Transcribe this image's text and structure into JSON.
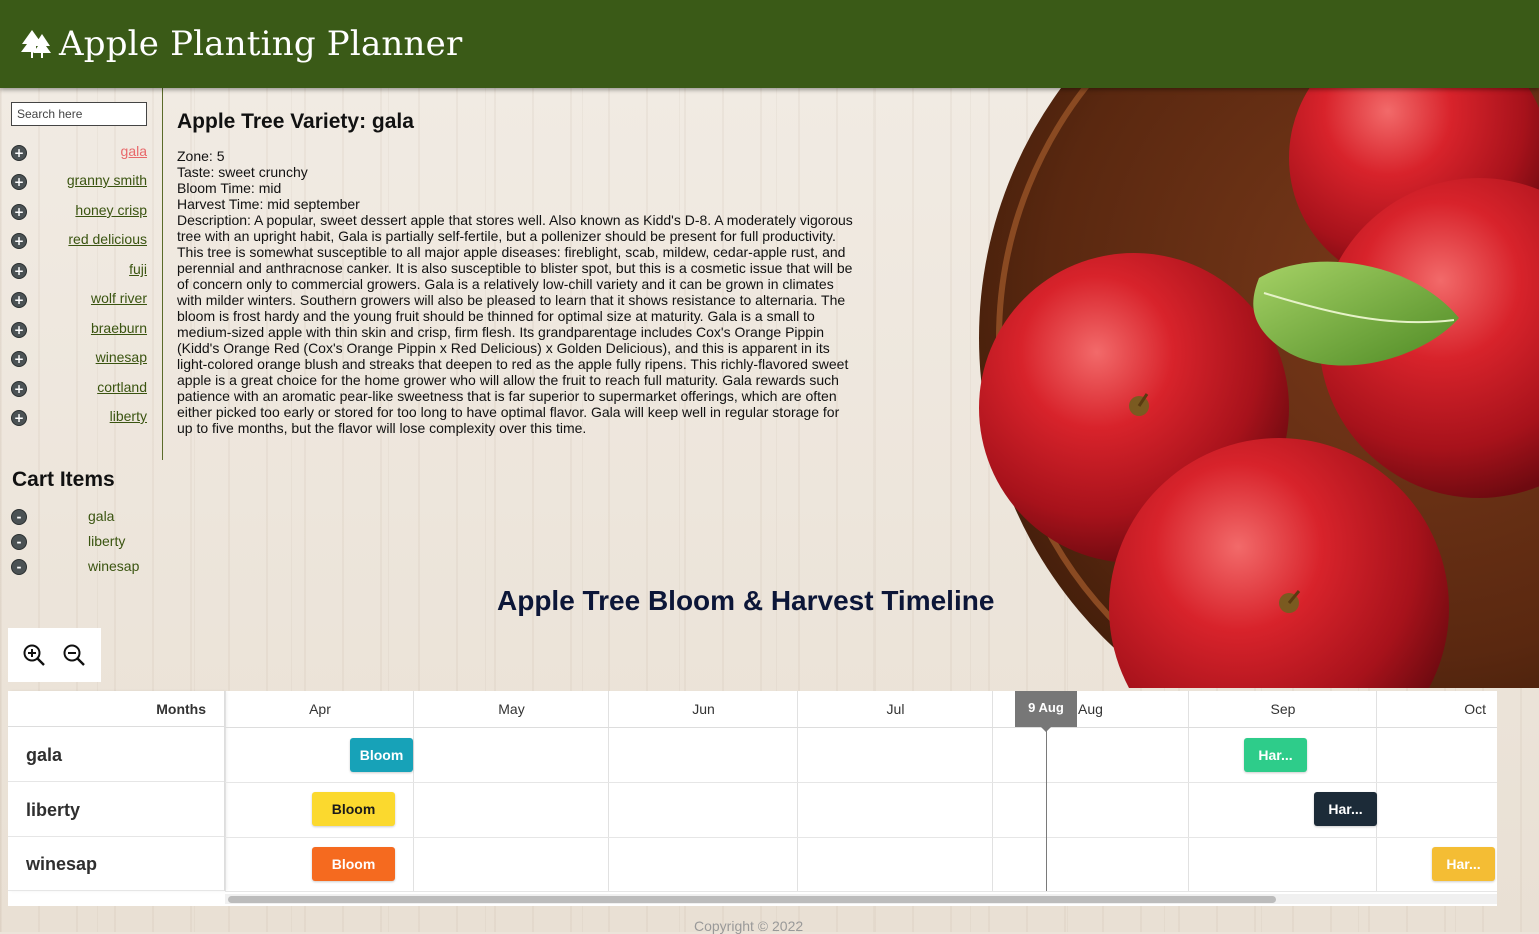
{
  "header": {
    "logo_icon": "tree-icon",
    "title": "Apple Planting Planner"
  },
  "sidebar": {
    "search_placeholder": "Search here",
    "add_icon": "+",
    "varieties": [
      {
        "name": "gala",
        "active": true
      },
      {
        "name": "granny smith"
      },
      {
        "name": "honey crisp"
      },
      {
        "name": "red delicious"
      },
      {
        "name": "fuji"
      },
      {
        "name": "wolf river"
      },
      {
        "name": "braeburn"
      },
      {
        "name": "winesap"
      },
      {
        "name": "cortland"
      },
      {
        "name": "liberty"
      }
    ]
  },
  "cart": {
    "title": "Cart Items",
    "remove_icon": "-",
    "items": [
      "gala",
      "liberty",
      "winesap"
    ]
  },
  "details": {
    "title": "Apple Tree Variety: gala",
    "zone": "Zone: 5",
    "taste": "Taste: sweet crunchy",
    "bloom": "Bloom Time: mid",
    "harvest": "Harvest Time: mid september",
    "description": "Description: A popular, sweet dessert apple that stores well. Also known as Kidd's D-8. A moderately vigorous tree with an upright habit, Gala is partially self-fertile, but a pollenizer should be present for full productivity. This tree is somewhat susceptible to all major apple diseases: fireblight, scab, mildew, cedar-apple rust, and perennial and anthracnose canker. It is also susceptible to blister spot, but this is a cosmetic issue that will be of concern only to commercial growers. Gala is a relatively low-chill variety and it can be grown in climates with milder winters. Southern growers will also be pleased to learn that it shows resistance to alternaria. The bloom is frost hardy and the young fruit should be thinned for optimal size at maturity. Gala is a small to medium-sized apple with thin skin and crisp, firm flesh. Its grandparentage includes Cox's Orange Pippin (Kidd's Orange Red (Cox's Orange Pippin x Red Delicious) x Golden Delicious), and this is apparent in its light-colored orange blush and streaks that deepen to red as the apple fully ripens. This richly-flavored sweet apple is a great choice for the home grower who will allow the fruit to reach full maturity. Gala rewards such patience with an aromatic pear-like sweetness that is far superior to supermarket offerings, which are often either picked too early or stored for too long to have optimal flavor. Gala will keep well in regular storage for up to five months, but the flavor will lose complexity over this time."
  },
  "timeline": {
    "title": "Apple Tree Bloom & Harvest Timeline",
    "zoom_in_icon": "zoom-in-icon",
    "zoom_out_icon": "zoom-out-icon",
    "left_header": "Months",
    "months": [
      "Apr",
      "May",
      "Jun",
      "Jul",
      "Aug",
      "Sep",
      "Oct"
    ],
    "today_label": "9 Aug",
    "rows": [
      {
        "name": "gala",
        "bloom": {
          "label": "Bloom",
          "color": "#17a2b8"
        },
        "harvest": {
          "label": "Har...",
          "color": "#2ecc8a"
        }
      },
      {
        "name": "liberty",
        "bloom": {
          "label": "Bloom",
          "color": "#fbd92e"
        },
        "harvest": {
          "label": "Har...",
          "color": "#1c2b38"
        }
      },
      {
        "name": "winesap",
        "bloom": {
          "label": "Bloom",
          "color": "#f56a1f"
        },
        "harvest": {
          "label": "Har...",
          "color": "#f4bd34"
        }
      }
    ]
  },
  "footer": {
    "copyright": "Copyright © 2022"
  }
}
